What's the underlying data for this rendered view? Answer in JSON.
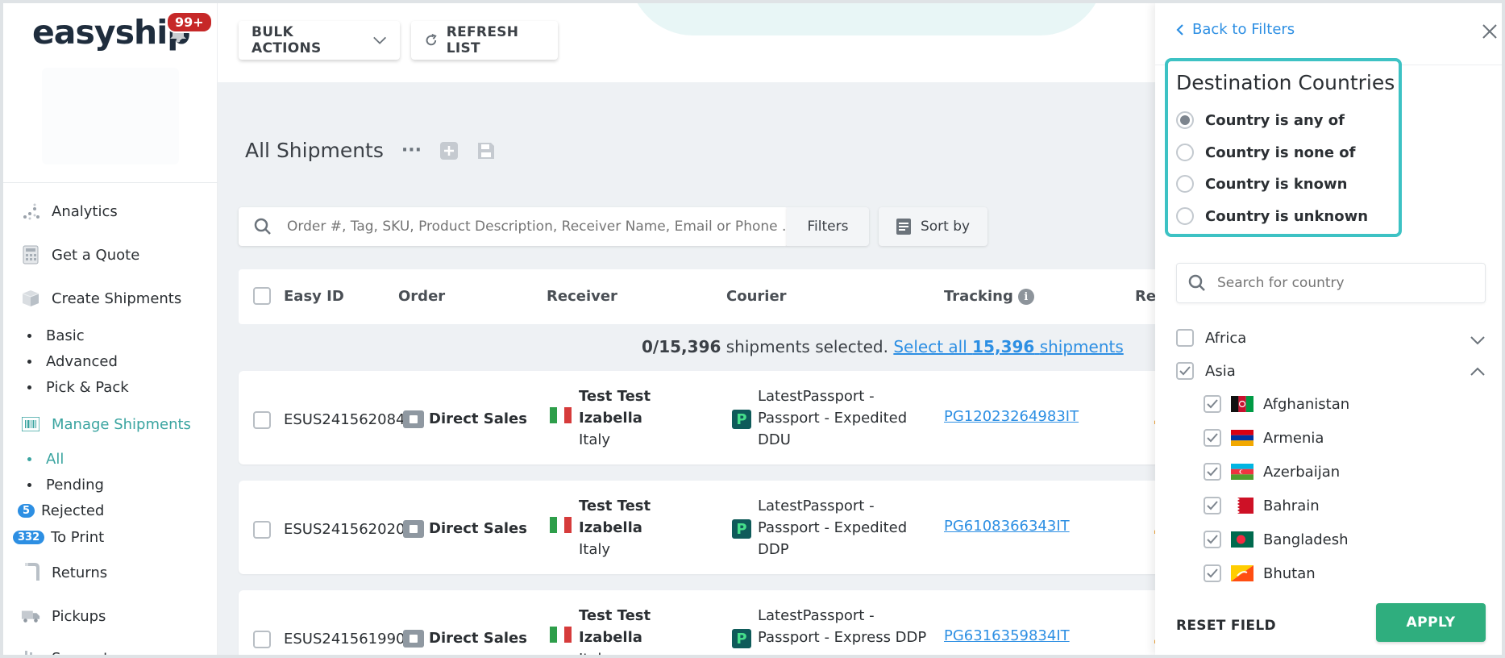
{
  "app": {
    "logo_text": "easyship",
    "notification_count": "99+"
  },
  "sidebar": {
    "items": [
      {
        "label": "Analytics",
        "icon": "analytics-icon"
      },
      {
        "label": "Get a Quote",
        "icon": "calculator-icon"
      },
      {
        "label": "Create Shipments",
        "icon": "box-icon"
      },
      {
        "label": "Manage Shipments",
        "icon": "barcode-icon"
      },
      {
        "label": "Returns",
        "icon": "return-icon"
      },
      {
        "label": "Pickups",
        "icon": "truck-icon"
      },
      {
        "label": "Support",
        "icon": "support-icon"
      }
    ],
    "create_sub": [
      "Basic",
      "Advanced",
      "Pick & Pack"
    ],
    "manage_sub": [
      "All",
      "Pending"
    ],
    "rejected": {
      "count": "5",
      "label": "Rejected"
    },
    "to_print": {
      "count": "332",
      "label": "To Print"
    }
  },
  "toolbar": {
    "bulk_actions": "BULK ACTIONS",
    "refresh_list": "REFRESH LIST"
  },
  "page": {
    "title": "All Shipments",
    "more": "···"
  },
  "search": {
    "placeholder": "Order #, Tag, SKU, Product Description, Receiver Name, Email or Phone ...",
    "filters_label": "Filters",
    "sort_label": "Sort by"
  },
  "table": {
    "headers": [
      "Easy ID",
      "Order",
      "Receiver",
      "Courier",
      "Tracking",
      "Rem"
    ],
    "selection": {
      "selected": "0/15,396",
      "text": "shipments selected.",
      "link_prefix": "Select all",
      "link_count": "15,396",
      "link_suffix": "shipments"
    },
    "rows": [
      {
        "easy_id": "ESUS241562084",
        "order": "Direct Sales",
        "receiver_name_1": "Test Test",
        "receiver_name_2": "Izabella",
        "receiver_country": "Italy",
        "courier_1": "LatestPassport -",
        "courier_2": "Passport - Expedited",
        "courier_3": "DDU",
        "tracking": "PG12023264983IT"
      },
      {
        "easy_id": "ESUS241562020",
        "order": "Direct Sales",
        "receiver_name_1": "Test Test",
        "receiver_name_2": "Izabella",
        "receiver_country": "Italy",
        "courier_1": "LatestPassport -",
        "courier_2": "Passport - Expedited",
        "courier_3": "DDP",
        "tracking": "PG6108366343IT"
      },
      {
        "easy_id": "ESUS241561990",
        "order": "Direct Sales",
        "receiver_name_1": "Test Test",
        "receiver_name_2": "Izabella",
        "receiver_country": "Italy",
        "courier_1": "LatestPassport -",
        "courier_2": "Passport - Express DDP",
        "courier_3": "",
        "tracking": "PG6316359834IT"
      }
    ]
  },
  "filter_panel": {
    "back_label": "Back to Filters",
    "title": "Destination Countries",
    "options": [
      {
        "label": "Country is any of",
        "selected": true
      },
      {
        "label": "Country is none of",
        "selected": false
      },
      {
        "label": "Country is known",
        "selected": false
      },
      {
        "label": "Country is unknown",
        "selected": false
      }
    ],
    "search_placeholder": "Search for country",
    "regions": [
      {
        "label": "Africa",
        "checked": false,
        "expanded": false
      },
      {
        "label": "Asia",
        "checked": true,
        "expanded": true
      }
    ],
    "countries": [
      {
        "label": "Afghanistan",
        "checked": true
      },
      {
        "label": "Armenia",
        "checked": true
      },
      {
        "label": "Azerbaijan",
        "checked": true
      },
      {
        "label": "Bahrain",
        "checked": true
      },
      {
        "label": "Bangladesh",
        "checked": true
      },
      {
        "label": "Bhutan",
        "checked": true
      }
    ],
    "reset_label": "RESET FIELD",
    "apply_label": "APPLY"
  },
  "colors": {
    "accent": "#3aa4a0",
    "link": "#2d8fe3",
    "apply": "#2fae7e",
    "highlight_border": "#3dc2c4",
    "notification": "#c62828"
  }
}
